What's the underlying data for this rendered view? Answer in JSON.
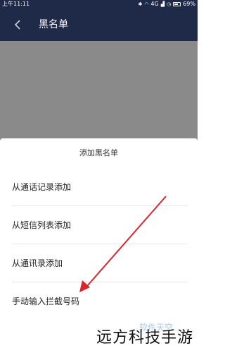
{
  "status_bar": {
    "time": "上午11:11",
    "icons": [
      "bluetooth-icon",
      "wifi-icon",
      "signal-4g-icon",
      "signal-icon",
      "alarm-icon"
    ],
    "network": "4G",
    "battery": "69%",
    "battery_level": 0.69
  },
  "header": {
    "back_icon": "chevron-left-icon",
    "title": "黑名单"
  },
  "sheet": {
    "title": "添加黑名单",
    "options": [
      {
        "label": "从通话记录添加"
      },
      {
        "label": "从短信列表添加"
      },
      {
        "label": "从通讯录添加"
      },
      {
        "label": "手动输入拦截号码"
      }
    ]
  },
  "annotation": {
    "color": "#d8262e"
  },
  "watermark": {
    "soft": "软件天空",
    "main": "远方科技手游"
  },
  "colors": {
    "header_bg": "#1f2a49",
    "overlay": "#8a8a8a",
    "sheet_bg": "#ffffff"
  }
}
